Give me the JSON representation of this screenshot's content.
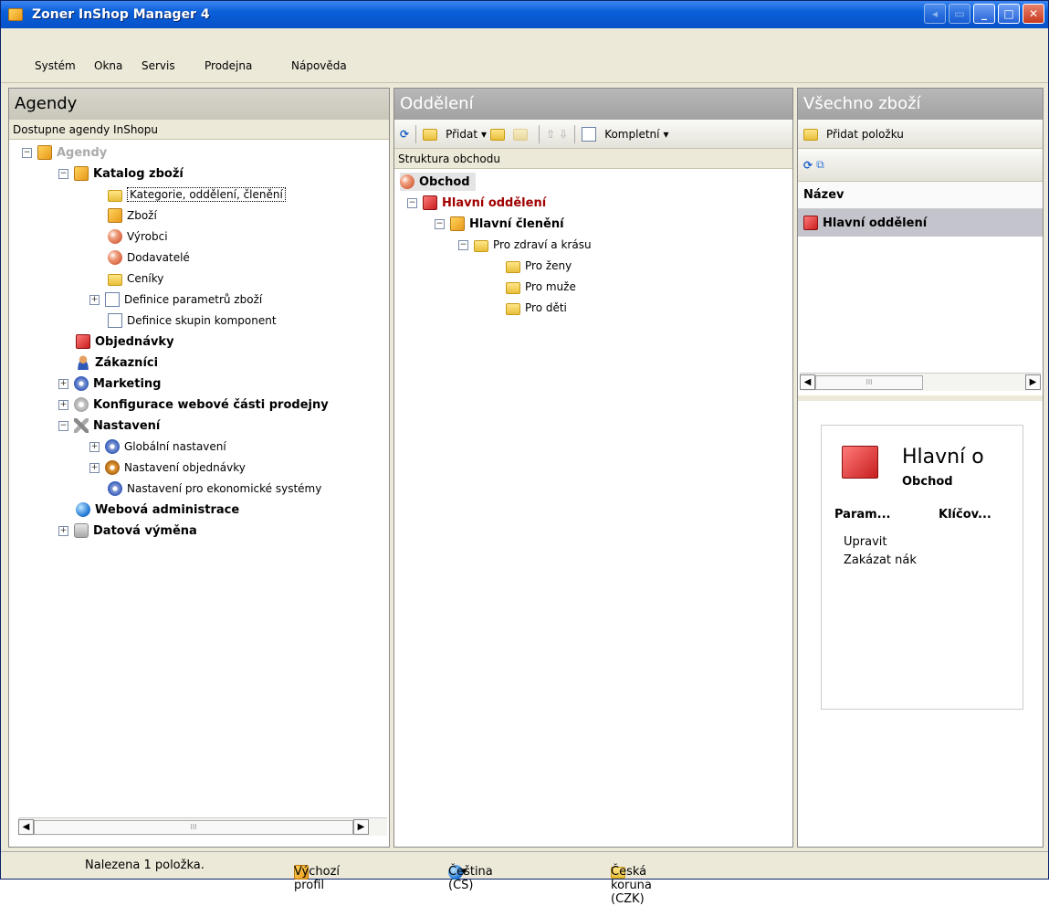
{
  "window": {
    "title": "Zoner InShop Manager 4"
  },
  "menu": [
    "Systém",
    "Okna",
    "Servis",
    "Prodejna",
    "Nápověda"
  ],
  "agendy": {
    "title": "Agendy",
    "subtitle": "Dostupne agendy InShopu",
    "items": [
      "Agendy",
      "Katalog zboží",
      "Kategorie, oddělení, členění",
      "Zboží",
      "Výrobci",
      "Dodavatelé",
      "Ceníky",
      "Definice parametrů zboží",
      "Definice skupin komponent",
      "Objednávky",
      "Zákazníci",
      "Marketing",
      "Konfigurace webové části prodejny",
      "Nastavení",
      "Globální nastavení",
      "Nastavení objednávky",
      "Nastavení pro ekonomické systémy",
      "Webová administrace",
      "Datová výměna"
    ]
  },
  "oddeleni": {
    "title": "Oddělení",
    "toolbar": {
      "add": "Přidat",
      "complete": "Kompletní"
    },
    "subtitle": "Struktura obchodu",
    "items": [
      "Obchod",
      "Hlavní oddělení",
      "Hlavní členění",
      "Pro zdraví a krásu",
      "Pro ženy",
      "Pro muže",
      "Pro děti"
    ]
  },
  "vse": {
    "title": "Všechno zboží",
    "add_label": "Přidat položku",
    "column": "Název",
    "row": "Hlavní oddělení",
    "card": {
      "title": "Hlavní o",
      "subtitle": "Obchod",
      "col1": "Param...",
      "col2": "Klíčov...",
      "link1": "Upravit",
      "link2": "Zakázat nák"
    }
  },
  "status": {
    "found": "Nalezena 1 položka.",
    "profile": "Výchozí profil",
    "language": "Čeština (CS)",
    "currency": "Česká koruna (CZK)"
  },
  "scroll_thumb": "III"
}
